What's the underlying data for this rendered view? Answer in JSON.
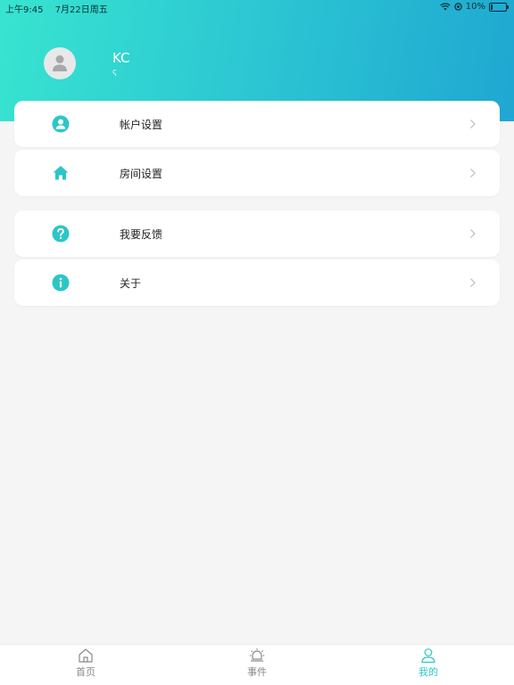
{
  "status_bar": {
    "time": "上午9:45",
    "date": "7月22日周五",
    "battery_percent": "10%",
    "battery_level": 0.1
  },
  "profile": {
    "name": "KC",
    "subtitle": "ς"
  },
  "menu": [
    {
      "label": "帐户设置",
      "icon": "user-circle-icon"
    },
    {
      "label": "房间设置",
      "icon": "home-icon"
    },
    {
      "label": "我要反馈",
      "icon": "question-icon"
    },
    {
      "label": "关于",
      "icon": "info-icon"
    }
  ],
  "tabbar": {
    "items": [
      {
        "label": "首页",
        "icon": "home-outline-icon",
        "active": false
      },
      {
        "label": "事件",
        "icon": "alarm-icon",
        "active": false
      },
      {
        "label": "我的",
        "icon": "person-icon",
        "active": true
      }
    ]
  },
  "colors": {
    "accent": "#2cc6c6",
    "gradient_start": "#38e4d0",
    "gradient_end": "#1fa7d2",
    "background": "#f5f5f5"
  }
}
